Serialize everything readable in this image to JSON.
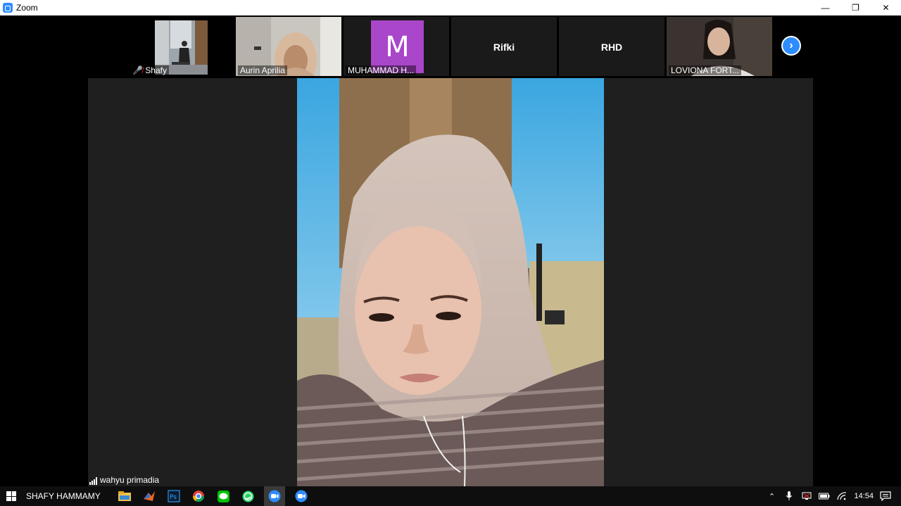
{
  "window": {
    "title": "Zoom",
    "controls": {
      "minimize": "—",
      "restore": "❐",
      "close": "✕"
    }
  },
  "gallery": {
    "participants": [
      {
        "name": "Shafy",
        "muted": true,
        "has_video": true
      },
      {
        "name": "Aurin Aprilia",
        "has_video": true
      },
      {
        "name": "MUHAMMAD H...",
        "avatar_letter": "M",
        "avatar_color": "#a946c9",
        "has_video": false
      },
      {
        "name": "Rifki",
        "has_video": false
      },
      {
        "name": "RHD",
        "has_video": false
      },
      {
        "name": "LOVIONA FORT...",
        "has_video": true
      }
    ],
    "next_icon": "›"
  },
  "active_speaker": {
    "name": "wahyu primadia"
  },
  "taskbar": {
    "user": "SHAFY HAMMAMY",
    "apps": [
      "file-explorer-icon",
      "matlab-icon",
      "photoshop-icon",
      "chrome-icon",
      "line-icon",
      "whatsapp-icon",
      "zoom-active-icon",
      "zoom-icon"
    ],
    "clock": "14:54"
  },
  "colors": {
    "accent": "#2d8cff",
    "stage_bg": "#1f1f1f",
    "avatar": "#a946c9"
  }
}
